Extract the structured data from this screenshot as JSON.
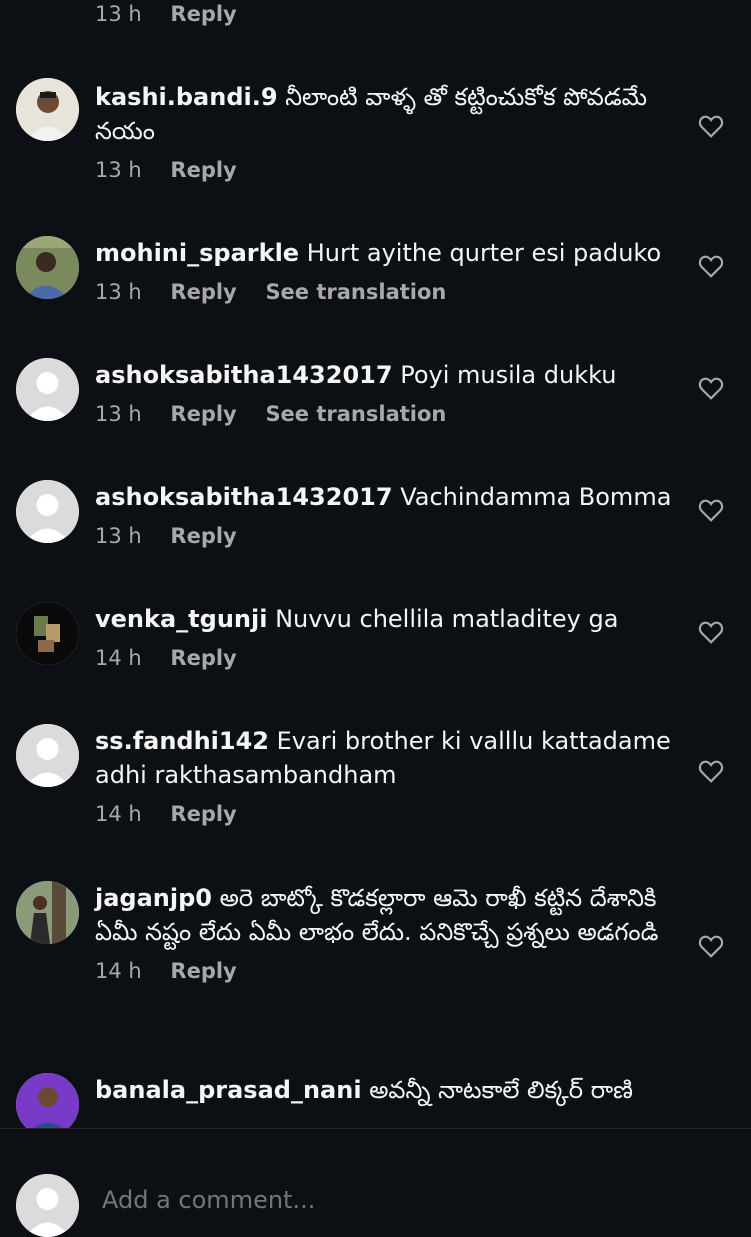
{
  "top_comment": {
    "time": "13 h",
    "reply": "Reply"
  },
  "comments": [
    {
      "username": "kashi.bandi.9",
      "text": "నీలాంటి వాళ్ళ తో కట్టించుకోక పోవడమే నయం",
      "time": "13 h",
      "reply": "Reply",
      "translate": ""
    },
    {
      "username": "mohini_sparkle",
      "text": "Hurt ayithe qurter esi paduko",
      "time": "13 h",
      "reply": "Reply",
      "translate": "See translation"
    },
    {
      "username": "ashoksabitha1432017",
      "text": "Poyi musila dukku",
      "time": "13 h",
      "reply": "Reply",
      "translate": "See translation"
    },
    {
      "username": "ashoksabitha1432017",
      "text": "Vachindamma Bomma",
      "time": "13 h",
      "reply": "Reply",
      "translate": ""
    },
    {
      "username": "venka_tgunji",
      "text": "Nuvvu chellila matladitey ga",
      "time": "14 h",
      "reply": "Reply",
      "translate": ""
    },
    {
      "username": "ss.fandhi142",
      "text": "Evari brother ki valllu kattadame adhi rakthasambandham",
      "time": "14 h",
      "reply": "Reply",
      "translate": ""
    },
    {
      "username": "jaganjp0",
      "text": "అరె బాట్కో కొడకల్లారా ఆమె రాఖీ కట్టిన దేశానికి ఏమీ నష్టం లేదు ఏమీ లాభం లేదు. పనికొచ్చే ప్రశ్నలు అడగండి",
      "time": "14 h",
      "reply": "Reply",
      "translate": ""
    },
    {
      "username": "banala_prasad_nani",
      "text": "అవన్నీ నాటకాలే లిక్కర్ రాణి",
      "time": "",
      "reply": "",
      "translate": ""
    }
  ],
  "composer": {
    "placeholder": "Add a comment..."
  },
  "colors": {
    "background": "#0c1014",
    "text": "#f5f5f5",
    "muted": "#a8a8a8"
  }
}
